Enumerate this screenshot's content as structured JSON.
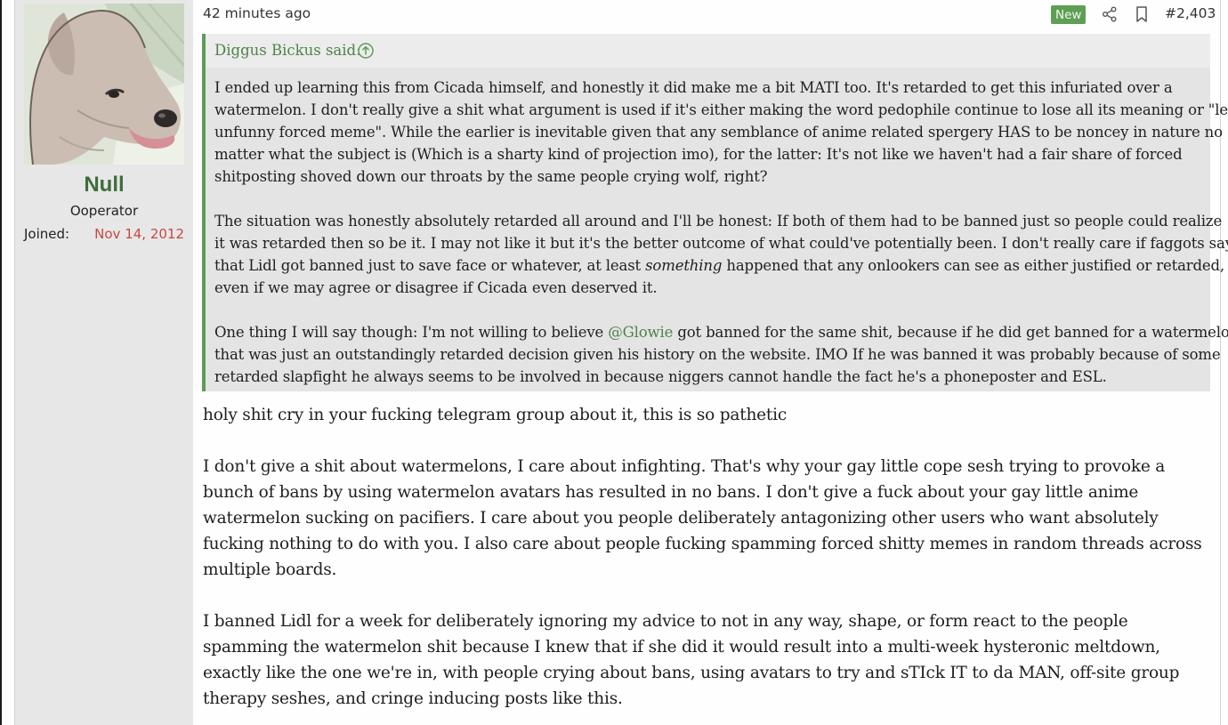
{
  "post": {
    "time": "42 minutes ago",
    "new_badge": "New",
    "number": "#2,403",
    "icons": {
      "share": "share-icon",
      "bookmark": "bookmark-icon",
      "quote_up": "arrow-up-circle-icon"
    }
  },
  "user": {
    "name": "Null",
    "title": "Ooperator",
    "joined_label": "Joined:",
    "joined_date": "Nov 14, 2012",
    "avatar": "dog-avatar"
  },
  "quote": {
    "author": "Diggus Bickus said:",
    "paragraphs": [
      {
        "lines": [
          "I ended up learning this from Cicada himself, and honestly it did make me a bit MATI too. It's retarded to get this infuriated over a",
          "watermelon. I don't really give a shit what argument is used if it's either making the word pedophile continue to lose all its meaning or \"le",
          "unfunny forced meme\". While the earlier is inevitable given that any semblance of anime related spergery HAS to be noncey in nature no",
          "matter what the subject is (Which is a sharty kind of projection imo), for the latter: It's not like we haven't had a fair share of forced",
          "shitposting shoved down our throats by the same people crying wolf, right?"
        ]
      },
      {
        "lines": [
          "The situation was honestly absolutely retarded all around and I'll be honest: If both of them had to be banned just so people could realize",
          "it was retarded then so be it. I may not like it but it's the better outcome of what could've potentially been. I don't really care if faggots say",
          "that Lidl got banned just to save face or whatever, at least ",
          "something",
          " happened that any onlookers can see as either justified or retarded,",
          "even if we may agree or disagree if Cicada even deserved it."
        ]
      },
      {
        "lines": [
          "One thing I will say though: I'm not willing to believe ",
          "@Glowie",
          " got banned for the same shit, because if he did get banned for a watermelon",
          "that was just an outstandingly retarded decision given his history on the website. IMO If he was banned it was probably because of some",
          "retarded slapfight he always seems to be involved in because niggers cannot handle the fact he's a phoneposter and ESL."
        ]
      }
    ]
  },
  "reply": {
    "paragraphs": [
      {
        "lines": [
          "holy shit cry in your fucking telegram group about it, this is so pathetic"
        ]
      },
      {
        "lines": [
          "I don't give a shit about watermelons, I care about infighting. That's why your gay little cope sesh trying to provoke a",
          "bunch of bans by using watermelon avatars has resulted in no bans. I don't give a fuck about your gay little anime",
          "watermelon sucking on pacifiers. I care about you people deliberately antagonizing other users who want absolutely",
          "fucking nothing to do with you. I also care about people fucking spamming forced shitty memes in random threads across",
          "multiple boards."
        ]
      },
      {
        "lines": [
          "I banned Lidl for a week for deliberately ignoring my advice to not in any way, shape, or form react to the people",
          "spamming the watermelon shit because I knew that if she did it would result into a multi-week hysteronic meltdown,",
          "exactly like the one we're in, with people crying about bans, using avatars to try and sTIck IT to da MAN, off-site group",
          "therapy seshes, and cringe inducing posts like this."
        ]
      }
    ]
  },
  "colors": {
    "accent_green": "#5e9b59",
    "username_green": "#3d6e3b",
    "joined_red": "#c34a3f",
    "sidebar_bg": "#e7e7e7",
    "quote_bg": "#e4e4e4"
  }
}
